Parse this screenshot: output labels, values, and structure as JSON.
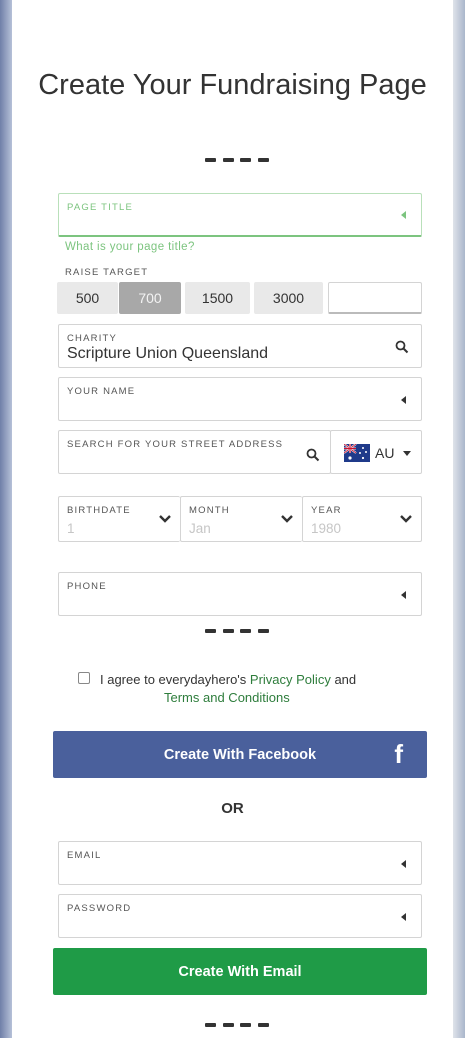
{
  "form": {
    "title": "Create Your Fundraising Page",
    "page_title": {
      "label": "PAGE TITLE",
      "value": "",
      "hint": "What is your page title?"
    },
    "raise_target": {
      "label": "RAISE TARGET",
      "options": [
        "500",
        "700",
        "1500",
        "3000"
      ],
      "selected": "700",
      "custom": ""
    },
    "charity": {
      "label": "CHARITY",
      "value": "Scripture Union Queensland"
    },
    "your_name": {
      "label": "YOUR NAME",
      "value": ""
    },
    "address": {
      "label": "SEARCH FOR YOUR STREET ADDRESS",
      "country_code": "AU"
    },
    "birthdate": {
      "day_label": "BIRTHDATE",
      "day_placeholder": "1",
      "month_label": "MONTH",
      "month_placeholder": "Jan",
      "year_label": "YEAR",
      "year_placeholder": "1980"
    },
    "phone": {
      "label": "PHONE",
      "value": ""
    },
    "consent": {
      "prefix": "I agree to everydayhero's ",
      "privacy_link": "Privacy Policy",
      "middle": " and",
      "terms_link": "Terms and Conditions",
      "checked": false
    },
    "facebook_button": "Create With Facebook",
    "facebook_icon": "f",
    "or_text": "OR",
    "email": {
      "label": "EMAIL",
      "value": ""
    },
    "password": {
      "label": "PASSWORD",
      "value": ""
    },
    "email_button": "Create With Email"
  },
  "colors": {
    "facebook": "#4a609c",
    "email_button": "#1f9b47",
    "hint_green": "#7cc47f",
    "link_green": "#2e7d3c",
    "selected_target": "#a8a8a8"
  },
  "icons": [
    "search-icon",
    "chevron-down-icon",
    "australia-flag-icon",
    "facebook-icon",
    "caret-left-icon"
  ]
}
